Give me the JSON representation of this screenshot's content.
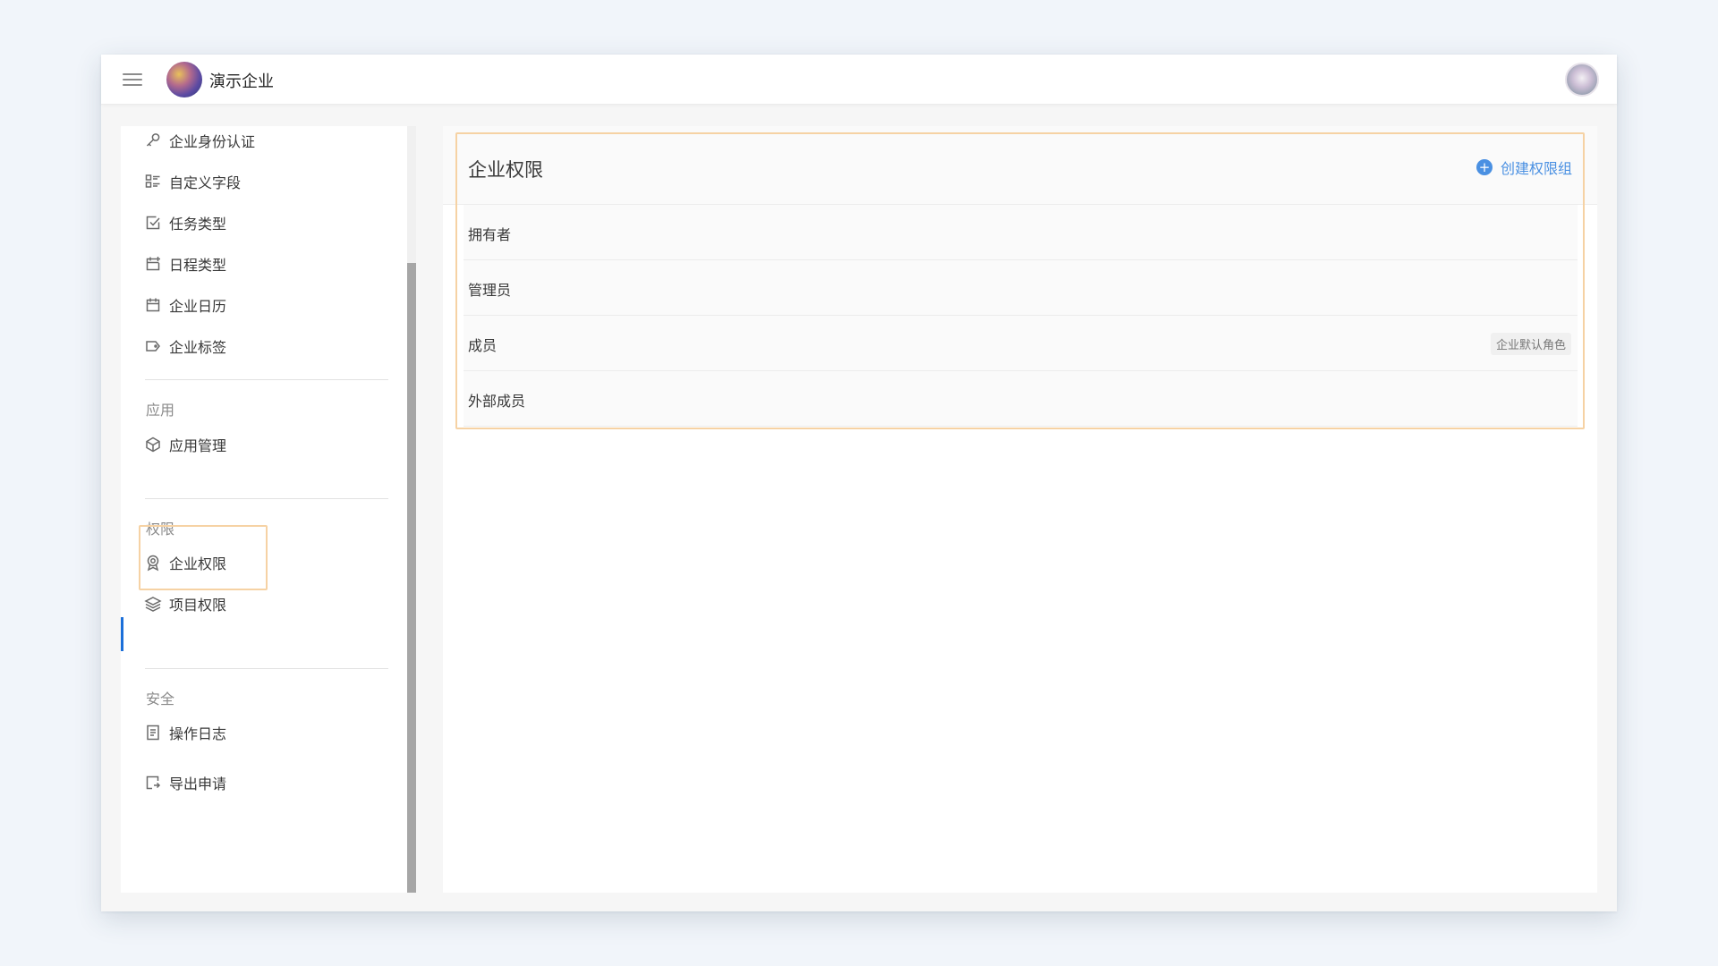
{
  "header": {
    "org_name": "演示企业",
    "menu_icon": "hamburger-icon",
    "logo": "org-logo",
    "avatar": "user-avatar"
  },
  "sidebar": {
    "items": [
      {
        "label": "企业身份认证",
        "icon": "key-icon"
      },
      {
        "label": "自定义字段",
        "icon": "custom-fields-icon"
      },
      {
        "label": "任务类型",
        "icon": "task-check-icon"
      },
      {
        "label": "日程类型",
        "icon": "calendar-plus-icon"
      },
      {
        "label": "企业日历",
        "icon": "calendar-icon"
      },
      {
        "label": "企业标签",
        "icon": "tag-icon"
      }
    ],
    "groups": [
      {
        "label": "应用",
        "items": [
          {
            "label": "应用管理",
            "icon": "cube-icon"
          }
        ]
      },
      {
        "label": "权限",
        "items": [
          {
            "label": "企业权限",
            "icon": "award-icon",
            "active": true
          },
          {
            "label": "项目权限",
            "icon": "layers-icon"
          }
        ]
      },
      {
        "label": "安全",
        "items": [
          {
            "label": "操作日志",
            "icon": "document-icon"
          },
          {
            "label": "导出申请",
            "icon": "export-icon"
          }
        ]
      }
    ]
  },
  "main": {
    "title": "企业权限",
    "create_label": "创建权限组",
    "roles": [
      {
        "name": "拥有者"
      },
      {
        "name": "管理员"
      },
      {
        "name": "成员",
        "tag": "企业默认角色"
      },
      {
        "name": "外部成员"
      }
    ]
  },
  "colors": {
    "accent": "#4a90e2",
    "active_indicator": "#1b6fd9",
    "highlight": "#f6d2a4",
    "background": "#f1f5fa"
  }
}
